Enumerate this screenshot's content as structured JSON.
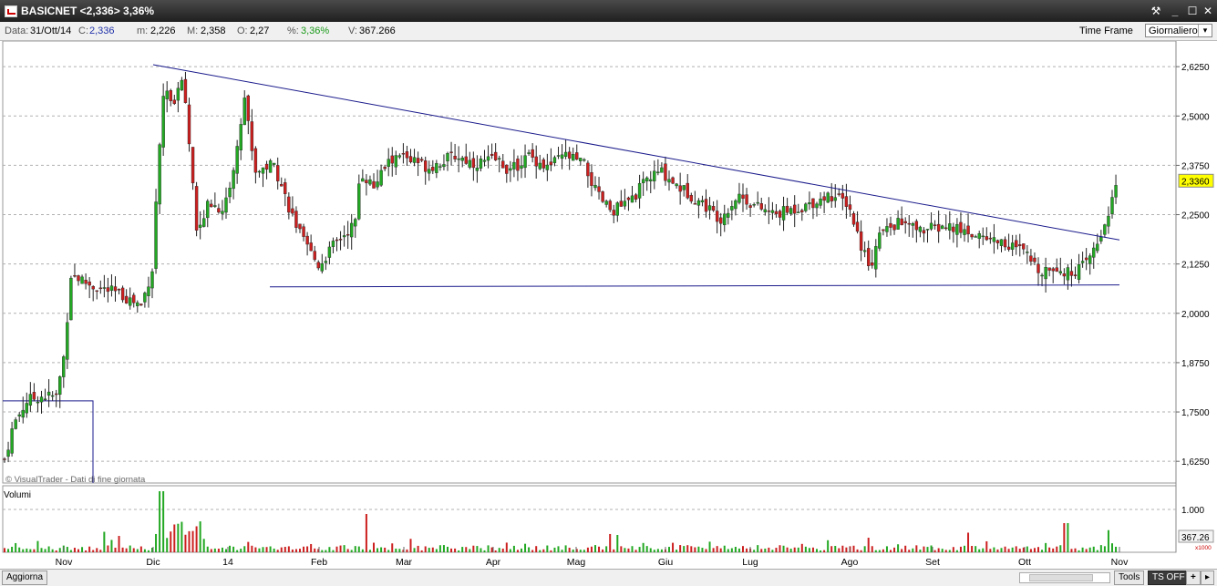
{
  "window": {
    "title": "BASICNET <2,336> 3,36%"
  },
  "info": {
    "data_label": "Data:",
    "data_value": "31/Ott/14",
    "c_label": "C:",
    "c_value": "2,336",
    "m_label": "m:",
    "m_value": "2,226",
    "M_label": "M:",
    "M_value": "2,358",
    "o_label": "O:",
    "o_value": "2,27",
    "pct_label": "%:",
    "pct_value": "3,36%",
    "v_label": "V:",
    "v_value": "367.266",
    "timeframe_label": "Time Frame",
    "timeframe_value": "Giornaliero"
  },
  "colors": {
    "up": "#22a822",
    "down": "#cc1f1f",
    "line": "#1a1a8c",
    "grid": "#b0b0b0",
    "price_badge": "#ffff00"
  },
  "chart_data": [
    {
      "type": "candlestick",
      "title": "",
      "y_ticks": [
        "2,6250",
        "2,5000",
        "2,3750",
        "2,2500",
        "2,1250",
        "2,0000",
        "1,8750",
        "1,7500",
        "1,6250"
      ],
      "y_values": [
        2.625,
        2.5,
        2.375,
        2.25,
        2.125,
        2.0,
        1.875,
        1.75,
        1.625
      ],
      "ylim": [
        1.57,
        2.69
      ],
      "x_ticks": [
        "Nov",
        "Dic",
        "14",
        "Feb",
        "Mar",
        "Apr",
        "Mag",
        "Giu",
        "Lug",
        "Ago",
        "Set",
        "Ott",
        "Nov"
      ],
      "last_price_label": "2,3360",
      "last_price": 2.336,
      "watermark": "© VisualTrader - Dati di fine giornata",
      "trendlines": [
        {
          "from": [
            "Dic",
            2.63
          ],
          "to": [
            "Nov",
            2.186
          ]
        },
        {
          "from": [
            "14",
            2.067
          ],
          "to": [
            "Nov",
            2.072
          ]
        }
      ],
      "grid": true
    },
    {
      "type": "bar",
      "title": "Volumi",
      "y_tick_label": "1.000",
      "last_value_label": "367.26",
      "unit_label": "x1000"
    }
  ],
  "bottom": {
    "aggiorna": "Aggiorna",
    "tools": "Tools",
    "ts_off": "TS OFF",
    "plus": "+",
    "menu": "▸"
  }
}
